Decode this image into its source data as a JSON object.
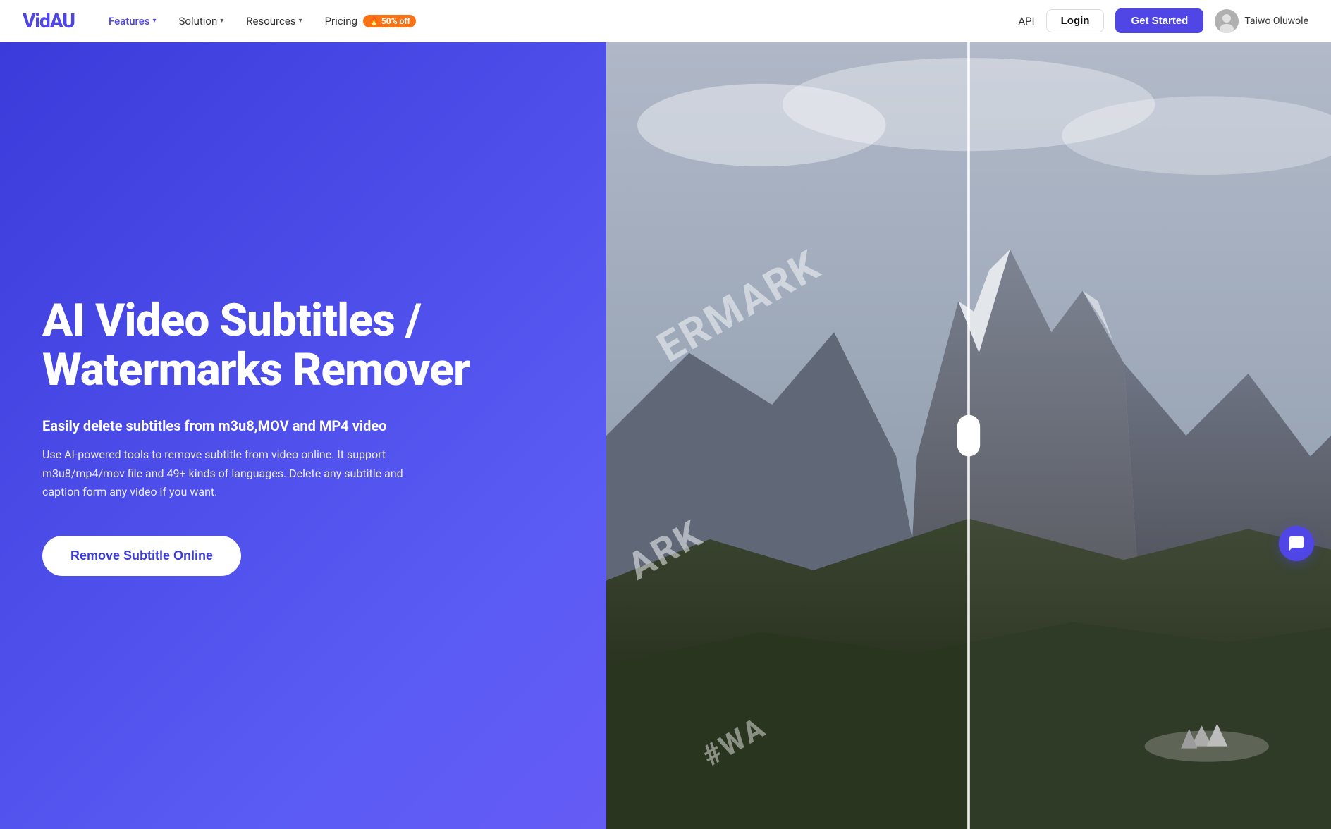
{
  "navbar": {
    "logo": "VidAU",
    "nav_items": [
      {
        "label": "Features",
        "has_dropdown": true,
        "active": true
      },
      {
        "label": "Solution",
        "has_dropdown": true,
        "active": false
      },
      {
        "label": "Resources",
        "has_dropdown": true,
        "active": false
      }
    ],
    "pricing_label": "Pricing",
    "badge_label": "🔥 50% off",
    "api_label": "API",
    "login_label": "Login",
    "get_started_label": "Get Started",
    "user_name": "Taiwo Oluwole"
  },
  "hero": {
    "title": "AI Video Subtitles /\nWatermarks Remover",
    "subtitle": "Easily delete subtitles from m3u8,MOV and MP4 video",
    "description": "Use AI-powered tools to remove subtitle from video online. It support m3u8/mp4/mov file and 49+ kinds of languages. Delete any subtitle and caption form any video if you want.",
    "cta_label": "Remove Subtitle Online",
    "watermarks": [
      "ERMARK",
      "ARK",
      "#W..."
    ]
  }
}
